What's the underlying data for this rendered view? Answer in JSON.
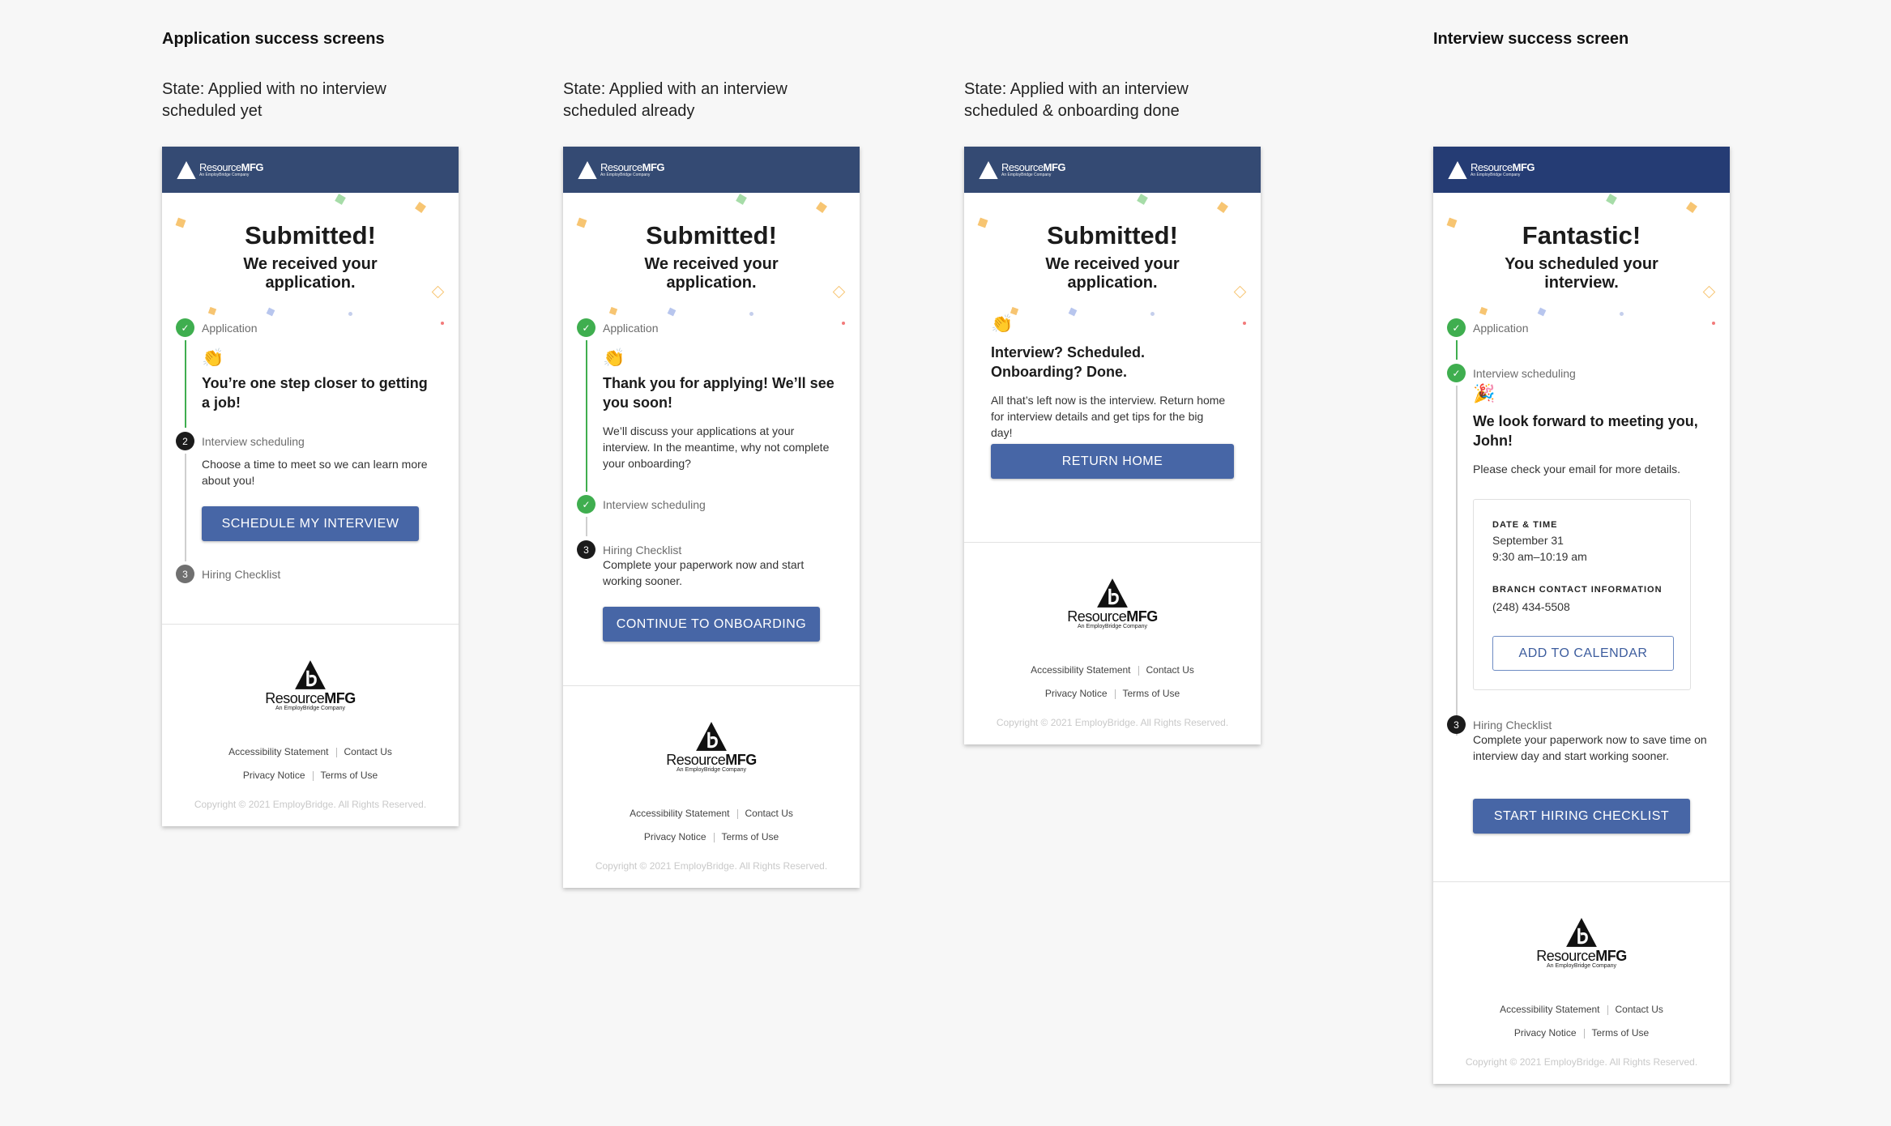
{
  "sections": {
    "application_title": "Application success screens",
    "interview_title": "Interview success screen"
  },
  "states": [
    "State: Applied with no interview scheduled yet",
    "State: Applied with an interview scheduled already",
    "State: Applied with an interview scheduled & onboarding done"
  ],
  "logo": {
    "brand_light": "Resource",
    "brand_bold": "MFG",
    "tagline": "An EmployBridge Company"
  },
  "footer": {
    "accessibility": "Accessibility Statement",
    "contact": "Contact Us",
    "privacy": "Privacy Notice",
    "terms": "Terms of Use",
    "copyright": "Copyright © 2021 EmployBridge. All Rights Reserved."
  },
  "screen1": {
    "title": "Submitted!",
    "subtitle": "We received your application.",
    "step1": "Application",
    "emoji": "👏",
    "heading": "You’re one step closer to getting a job!",
    "step2_num": "2",
    "step2": "Interview scheduling",
    "step2_text": "Choose a time to meet so we can learn more about you!",
    "button": "SCHEDULE MY INTERVIEW",
    "step3_num": "3",
    "step3": "Hiring Checklist"
  },
  "screen2": {
    "title": "Submitted!",
    "subtitle": "We received your application.",
    "step1": "Application",
    "emoji": "👏",
    "heading": "Thank you for applying! We’ll see you soon!",
    "text": "We’ll discuss your applications at your interview. In the meantime, why not complete your onboarding?",
    "step2": "Interview scheduling",
    "step3_num": "3",
    "step3": "Hiring Checklist",
    "step3_text": "Complete your paperwork now and start working sooner.",
    "button": "CONTINUE TO ONBOARDING"
  },
  "screen3": {
    "title": "Submitted!",
    "subtitle": "We received your application.",
    "emoji": "👏",
    "heading": "Interview? Scheduled. Onboarding? Done.",
    "text": "All that’s left now is the interview. Return home for interview details and get tips for the big day!",
    "button": "RETURN HOME"
  },
  "screen4": {
    "title": "Fantastic!",
    "subtitle": "You scheduled your interview.",
    "step1": "Application",
    "step2": "Interview scheduling",
    "emoji": "🎉",
    "heading": "We look forward to meeting you, John!",
    "text": "Please check your email for more details.",
    "date_label": "DATE & TIME",
    "date_value": "September 31",
    "time_value": "9:30 am–10:19 am",
    "branch_label": "BRANCH CONTACT INFORMATION",
    "branch_phone": "(248) 434-5508",
    "calendar_button": "ADD TO CALENDAR",
    "step3_num": "3",
    "step3": "Hiring Checklist",
    "step3_text": "Complete your paperwork now to save time on interview day and start working sooner.",
    "button": "START HIRING CHECKLIST"
  },
  "colors": {
    "header": "#344a73",
    "primary_button": "#4766a6",
    "success_green": "#3fae4f"
  }
}
